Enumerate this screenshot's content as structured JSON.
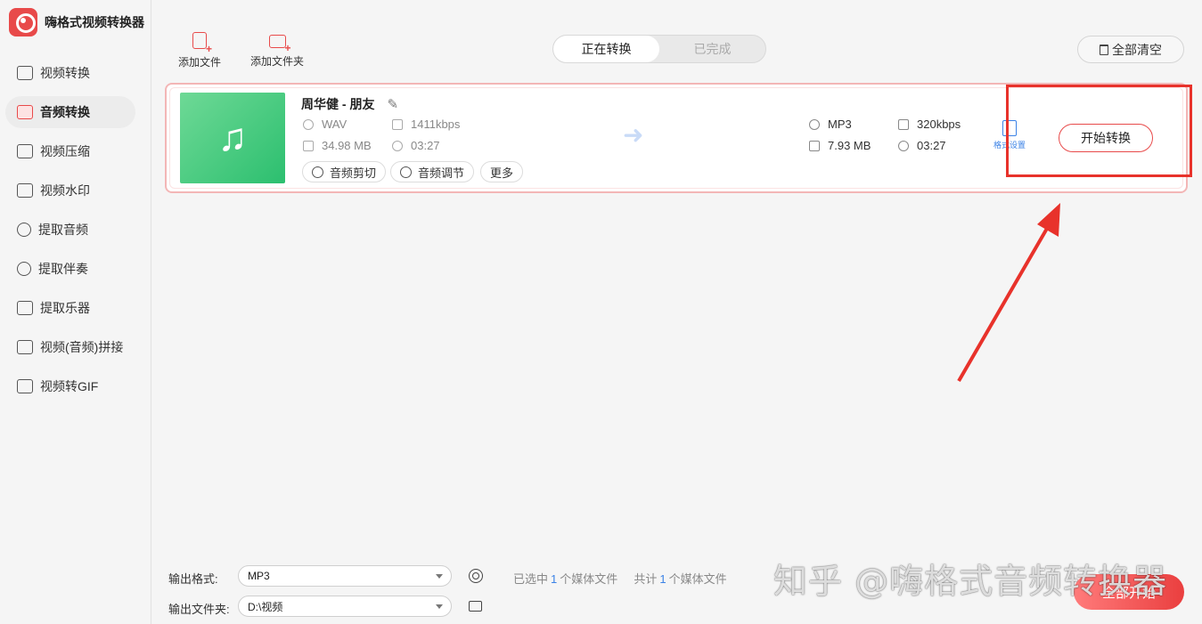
{
  "app": {
    "title": "嗨格式视频转换器"
  },
  "sidebar": {
    "items": [
      {
        "label": "视频转换",
        "icon": "video-convert-icon",
        "active": false
      },
      {
        "label": "音频转换",
        "icon": "audio-convert-icon",
        "active": true
      },
      {
        "label": "视频压缩",
        "icon": "video-compress-icon",
        "active": false
      },
      {
        "label": "视频水印",
        "icon": "video-watermark-icon",
        "active": false
      },
      {
        "label": "提取音频",
        "icon": "extract-audio-icon",
        "active": false
      },
      {
        "label": "提取伴奏",
        "icon": "extract-accompaniment-icon",
        "active": false
      },
      {
        "label": "提取乐器",
        "icon": "extract-instrument-icon",
        "active": false
      },
      {
        "label": "视频(音频)拼接",
        "icon": "merge-icon",
        "active": false
      },
      {
        "label": "视频转GIF",
        "icon": "gif-icon",
        "active": false
      }
    ]
  },
  "toolbar": {
    "add_file": "添加文件",
    "add_folder": "添加文件夹",
    "tabs": [
      {
        "label": "正在转换",
        "active": true
      },
      {
        "label": "已完成",
        "active": false
      }
    ],
    "clear_all": "全部清空"
  },
  "file": {
    "name": "周华健 - 朋友",
    "source": {
      "format": "WAV",
      "bitrate": "1411kbps",
      "size": "34.98 MB",
      "duration": "03:27"
    },
    "output": {
      "format": "MP3",
      "bitrate": "320kbps",
      "size": "7.93 MB",
      "duration": "03:27"
    },
    "actions": {
      "cut": "音频剪切",
      "adjust": "音频调节",
      "more": "更多"
    },
    "format_settings": "格式设置",
    "start": "开始转换"
  },
  "bottom": {
    "output_format_label": "输出格式:",
    "output_format_value": "MP3",
    "output_folder_label": "输出文件夹:",
    "output_folder_value": "D:\\视频",
    "selected_prefix": "已选中",
    "selected_count": "1",
    "selected_suffix": "个媒体文件",
    "total_prefix": "共计",
    "total_count": "1",
    "total_suffix": "个媒体文件",
    "start_all": "全部开始"
  },
  "watermark": "知乎 @嗨格式音频转换器",
  "colors": {
    "accent": "#e84a4a",
    "link": "#3b82e6",
    "annotation": "#e8322b"
  }
}
